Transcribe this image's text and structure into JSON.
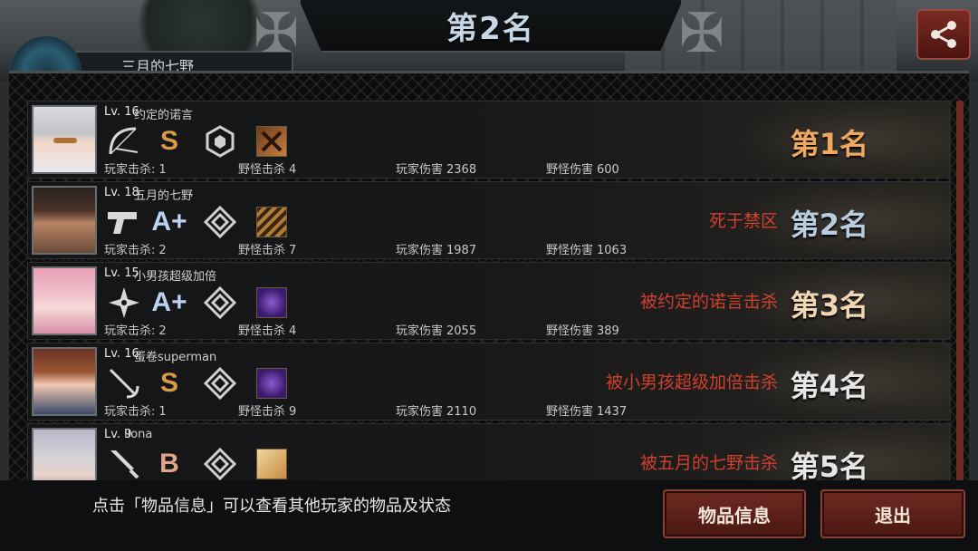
{
  "header": {
    "title": "第2名",
    "partial_label": "三月的七野"
  },
  "rows": [
    {
      "level": "Lv. 16",
      "name": "约定的诺言",
      "grade": "S",
      "weapon_icon": "bow-icon",
      "armor_icon": "hexagon-badge-icon",
      "item_icon": "crossed-items-icon",
      "player_kills_label": "玩家击杀:",
      "player_kills": "1",
      "monster_kills_label": "野怪击杀",
      "monster_kills": "4",
      "player_damage_label": "玩家伤害",
      "player_damage": "2368",
      "monster_damage_label": "野怪伤害",
      "monster_damage": "600",
      "death": "",
      "rank": "第1名"
    },
    {
      "level": "Lv. 18",
      "name": "五月的七野",
      "grade": "A+",
      "weapon_icon": "pistol-icon",
      "armor_icon": "diamond-badge-icon",
      "item_icon": "ammo-belt-icon",
      "player_kills_label": "玩家击杀:",
      "player_kills": "2",
      "monster_kills_label": "野怪击杀",
      "monster_kills": "7",
      "player_damage_label": "玩家伤害",
      "player_damage": "1987",
      "monster_damage_label": "野怪伤害",
      "monster_damage": "1063",
      "death": "死于禁区",
      "rank": "第2名"
    },
    {
      "level": "Lv. 15",
      "name": "小男孩超级加倍",
      "grade": "A+",
      "weapon_icon": "shuriken-icon",
      "armor_icon": "diamond-badge-icon",
      "item_icon": "purple-claw-icon",
      "player_kills_label": "玩家击杀:",
      "player_kills": "2",
      "monster_kills_label": "野怪击杀",
      "monster_kills": "4",
      "player_damage_label": "玩家伤害",
      "player_damage": "2055",
      "monster_damage_label": "野怪伤害",
      "monster_damage": "389",
      "death": "被约定的诺言击杀",
      "rank": "第3名"
    },
    {
      "level": "Lv. 16",
      "name": "蛋卷superman",
      "grade": "S",
      "weapon_icon": "rapier-icon",
      "armor_icon": "diamond-badge-icon",
      "item_icon": "purple-claw-icon",
      "player_kills_label": "玩家击杀:",
      "player_kills": "1",
      "monster_kills_label": "野怪击杀",
      "monster_kills": "9",
      "player_damage_label": "玩家伤害",
      "player_damage": "2110",
      "monster_damage_label": "野怪伤害",
      "monster_damage": "1437",
      "death": "被小男孩超级加倍击杀",
      "rank": "第4名"
    },
    {
      "level": "Lv. 9",
      "name": "llona",
      "grade": "B",
      "weapon_icon": "knife-icon",
      "armor_icon": "diamond-badge-icon",
      "item_icon": "gold-fist-icon",
      "death": "被五月的七野击杀",
      "rank": "第5名"
    }
  ],
  "footer": {
    "hint": "点击「物品信息」可以查看其他玩家的物品及状态",
    "info_button": "物品信息",
    "exit_button": "退出"
  },
  "colors": {
    "rank1": "#f0a860",
    "death_text": "#d0402e",
    "button_bg": "#6e2a22"
  }
}
